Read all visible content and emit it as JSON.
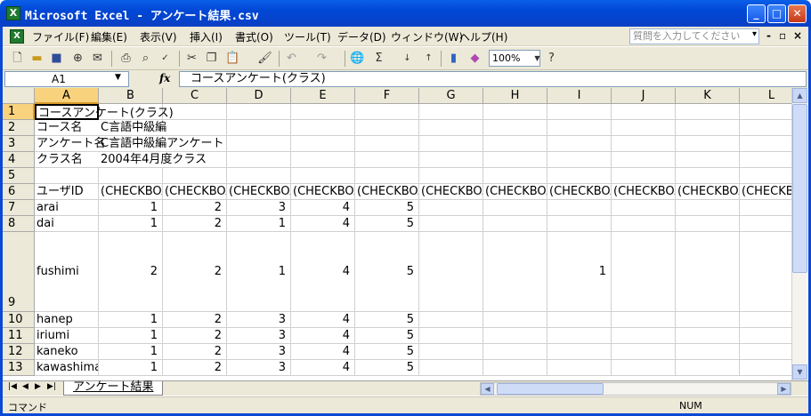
{
  "window": {
    "title": "Microsoft Excel - アンケート結果.csv",
    "app_icon": "X",
    "minimize": "_",
    "maximize": "□",
    "close": "✕"
  },
  "menu": {
    "items": [
      "ファイル(F)",
      "編集(E)",
      "表示(V)",
      "挿入(I)",
      "書式(O)",
      "ツール(T)",
      "データ(D)",
      "ウィンドウ(W)",
      "ヘルプ(H)"
    ],
    "help_placeholder": "質問を入力してください",
    "help_arrow": "▾",
    "window_min": "-",
    "window_restore": "▫",
    "window_close": "×"
  },
  "toolbar": {
    "zoom": "100%"
  },
  "formula": {
    "cell_ref": "A1",
    "fx": "fx",
    "content": "コースアンケート(クラス)"
  },
  "grid": {
    "columns": [
      "A",
      "B",
      "C",
      "D",
      "E",
      "F",
      "G",
      "H",
      "I",
      "J",
      "K",
      "L"
    ],
    "rows": [
      {
        "n": "1",
        "cells": [
          "コースアンケート(クラス)",
          "",
          "",
          "",
          "",
          "",
          "",
          "",
          "",
          "",
          "",
          ""
        ]
      },
      {
        "n": "2",
        "cells": [
          "コース名",
          "C言語中級編",
          "",
          "",
          "",
          "",
          "",
          "",
          "",
          "",
          "",
          ""
        ]
      },
      {
        "n": "3",
        "cells": [
          "アンケート名",
          "C言語中級編アンケート",
          "",
          "",
          "",
          "",
          "",
          "",
          "",
          "",
          "",
          ""
        ]
      },
      {
        "n": "4",
        "cells": [
          "クラス名",
          "2004年4月度クラス",
          "",
          "",
          "",
          "",
          "",
          "",
          "",
          "",
          "",
          ""
        ]
      },
      {
        "n": "5",
        "cells": [
          "",
          "",
          "",
          "",
          "",
          "",
          "",
          "",
          "",
          "",
          "",
          ""
        ]
      },
      {
        "n": "6",
        "cells": [
          "ユーザID",
          "(CHECKBOX)",
          "(CHECKBOX)",
          "(CHECKBOX)",
          "(CHECKBOX)",
          "(CHECKBOX)",
          "(CHECKBOX)",
          "(CHECKBOX)",
          "(CHECKBOX)",
          "(CHECKBOX)",
          "(CHECKBOX)",
          "(CHECKBOX)"
        ]
      },
      {
        "n": "7",
        "cells": [
          "arai",
          "1",
          "2",
          "3",
          "4",
          "5",
          "",
          "",
          "",
          "",
          "",
          ""
        ]
      },
      {
        "n": "8",
        "cells": [
          "dai",
          "1",
          "2",
          "1",
          "4",
          "5",
          "",
          "",
          "",
          "",
          "",
          ""
        ]
      },
      {
        "n": "9",
        "cells": [
          "fushimi",
          "2",
          "2",
          "1",
          "4",
          "5",
          "",
          "",
          "1",
          "",
          "",
          ""
        ]
      },
      {
        "n": "10",
        "cells": [
          "hanep",
          "1",
          "2",
          "3",
          "4",
          "5",
          "",
          "",
          "",
          "",
          "",
          ""
        ]
      },
      {
        "n": "11",
        "cells": [
          "iriumi",
          "1",
          "2",
          "3",
          "4",
          "5",
          "",
          "",
          "",
          "",
          "",
          ""
        ]
      },
      {
        "n": "12",
        "cells": [
          "kaneko",
          "1",
          "2",
          "3",
          "4",
          "5",
          "",
          "",
          "",
          "",
          "",
          ""
        ]
      },
      {
        "n": "13",
        "cells": [
          "kawashima",
          "1",
          "2",
          "3",
          "4",
          "5",
          "",
          "",
          "",
          "",
          "",
          ""
        ]
      }
    ]
  },
  "sheet_tab": "アンケート結果",
  "status": {
    "mode": "コマンド",
    "num": "NUM"
  }
}
